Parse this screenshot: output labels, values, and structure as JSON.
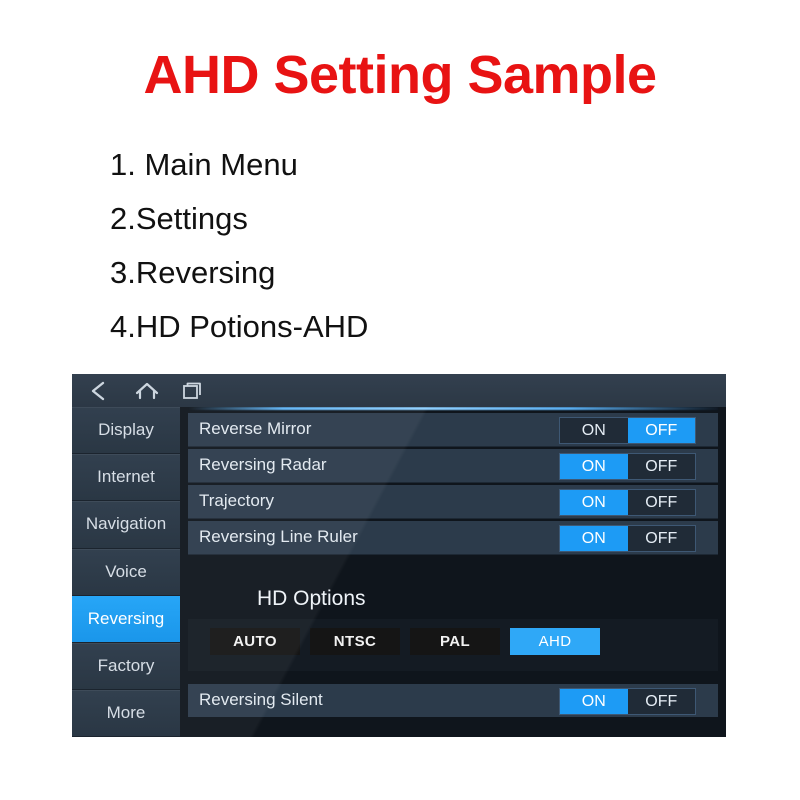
{
  "doc": {
    "title": "AHD Setting Sample",
    "steps": [
      "1. Main Menu",
      "2.Settings",
      "3.Reversing",
      "4.HD Potions-AHD"
    ]
  },
  "colors": {
    "title_red": "#e81313",
    "accent_blue": "#1d9bf5",
    "selected_blue": "#2fa8f7",
    "row_bg": "#2c3b4b",
    "sidebar_bg": "#2e3c4b",
    "panel_bg": "#141b23"
  },
  "device": {
    "navbar": {
      "back_icon": "back-chevron-icon",
      "home_icon": "home-icon",
      "recent_icon": "recent-apps-icon"
    },
    "sidebar": {
      "items": [
        {
          "label": "Display",
          "active": false
        },
        {
          "label": "Internet",
          "active": false
        },
        {
          "label": "Navigation",
          "active": false
        },
        {
          "label": "Voice",
          "active": false
        },
        {
          "label": "Reversing",
          "active": true
        },
        {
          "label": "Factory",
          "active": false
        },
        {
          "label": "More",
          "active": false
        }
      ]
    },
    "settings": {
      "toggle_on_label": "ON",
      "toggle_off_label": "OFF",
      "rows": [
        {
          "label": "Reverse Mirror",
          "value": "OFF"
        },
        {
          "label": "Reversing Radar",
          "value": "ON"
        },
        {
          "label": "Trajectory",
          "value": "ON"
        },
        {
          "label": "Reversing Line Ruler",
          "value": "ON"
        }
      ],
      "hd_options": {
        "heading": "HD Options",
        "buttons": [
          {
            "label": "AUTO",
            "selected": false
          },
          {
            "label": "NTSC",
            "selected": false
          },
          {
            "label": "PAL",
            "selected": false
          },
          {
            "label": "AHD",
            "selected": true
          }
        ]
      },
      "bottom_row": {
        "label": "Reversing Silent",
        "value": "ON"
      }
    }
  }
}
